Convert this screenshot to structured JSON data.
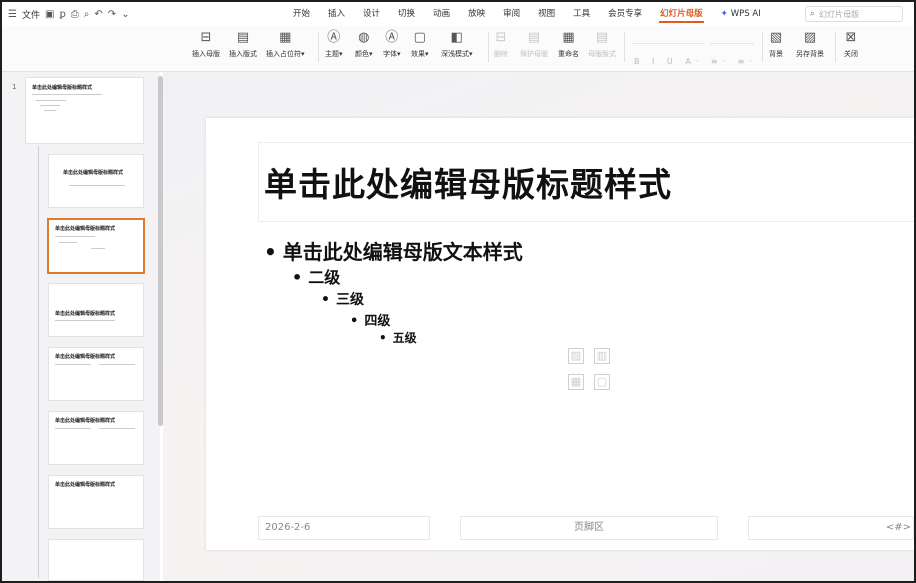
{
  "topbar": {
    "file_menu": "文件",
    "quick_access_icons": [
      "save-icon",
      "format-painter-icon",
      "print-icon",
      "print-preview-icon",
      "undo-icon",
      "redo-icon",
      "dropdown-icon"
    ],
    "tabs": [
      "开始",
      "插入",
      "设计",
      "切换",
      "动画",
      "放映",
      "审阅",
      "视图",
      "工具",
      "会员专享",
      "幻灯片母版",
      "WPS AI"
    ],
    "active_tab": "幻灯片母版",
    "search_placeholder": "幻灯片母版"
  },
  "ribbon": {
    "insert_master": "插入母版",
    "insert_layout": "插入版式",
    "insert_placeholder": "插入占位符",
    "theme": "主题",
    "colors": "颜色",
    "fonts": "字体",
    "effects": "效果",
    "background_style": "深浅模式",
    "delete": "删除",
    "preserve_master": "保护母版",
    "rename": "重命名",
    "master_layout": "母版版式",
    "background": "背景",
    "save_background": "另存背景",
    "close": "关闭"
  },
  "sidebar": {
    "slide_number": "1",
    "thumbs": [
      {
        "title": "单击此处编辑母版标题样式"
      },
      {
        "title": "单击此处编辑母版标题样式"
      },
      {
        "title": "单击此处编辑母版标题样式"
      },
      {
        "title": "单击此处编辑母版标题样式"
      },
      {
        "title": "单击此处编辑母版标题样式"
      },
      {
        "title": "单击此处编辑母版标题样式"
      },
      {
        "title": "单击此处编辑母版标题样式"
      }
    ]
  },
  "slide": {
    "title": "单击此处编辑母版标题样式",
    "levels": [
      "单击此处编辑母版文本样式",
      "二级",
      "三级",
      "四级",
      "五级"
    ],
    "date": "2026-2-6",
    "footer": "页脚区",
    "number": "<#>"
  },
  "colors": {
    "accent": "#e05a26",
    "selected_thumb_border": "#e2772e"
  }
}
